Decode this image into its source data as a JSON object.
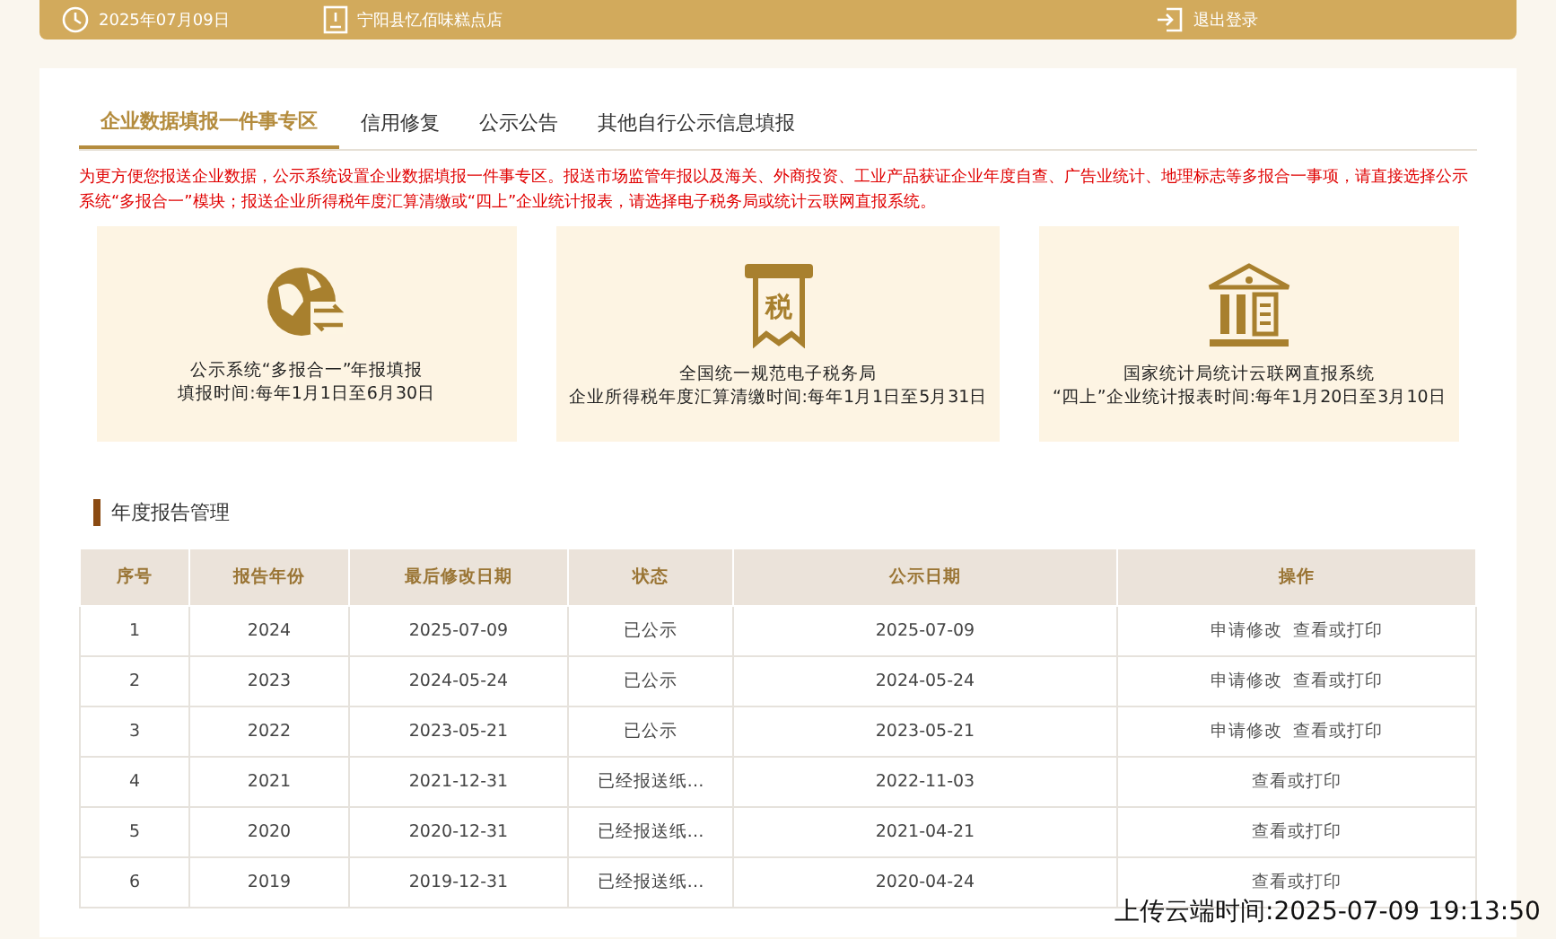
{
  "top_bar": {
    "date": "2025年07月09日",
    "store": "宁阳县忆佰味糕点店",
    "logout": "退出登录"
  },
  "tabs": [
    {
      "label": "企业数据填报一件事专区",
      "selected": true
    },
    {
      "label": "信用修复",
      "selected": false
    },
    {
      "label": "公示公告",
      "selected": false
    },
    {
      "label": "其他自行公示信息填报",
      "selected": false
    }
  ],
  "notice": "为更方便您报送企业数据，公示系统设置企业数据填报一件事专区。报送市场监管年报以及海关、外商投资、工业产品获证企业年度自查、广告业统计、地理标志等多报合一事项，请直接选择公示系统“多报合一”模块；报送企业所得税年度汇算清缴或“四上”企业统计报表，请选择电子税务局或统计云联网直报系统。",
  "cards": [
    {
      "kind": "globe",
      "title": "公示系统“多报合一”年报填报",
      "period": "填报时间:每年1月1日至6月30日"
    },
    {
      "kind": "tax",
      "icon_text": "税",
      "title": "全国统一规范电子税务局",
      "period": "企业所得税年度汇算清缴时间:每年1月1日至5月31日"
    },
    {
      "kind": "bank",
      "title": "国家统计局统计云联网直报系统",
      "period": "“四上”企业统计报表时间:每年1月20日至3月10日"
    }
  ],
  "section_title": "年度报告管理",
  "table": {
    "columns": [
      "序号",
      "报告年份",
      "最后修改日期",
      "状态",
      "公示日期",
      "操作"
    ],
    "rows": [
      {
        "cells": [
          "1",
          "2024",
          "2025-07-09",
          "已公示",
          "2025-07-09"
        ],
        "actions": [
          "申请修改",
          "查看或打印"
        ]
      },
      {
        "cells": [
          "2",
          "2023",
          "2024-05-24",
          "已公示",
          "2024-05-24"
        ],
        "actions": [
          "申请修改",
          "查看或打印"
        ]
      },
      {
        "cells": [
          "3",
          "2022",
          "2023-05-21",
          "已公示",
          "2023-05-21"
        ],
        "actions": [
          "申请修改",
          "查看或打印"
        ]
      },
      {
        "cells": [
          "4",
          "2021",
          "2021-12-31",
          "已经报送纸…",
          "2022-11-03"
        ],
        "actions": [
          "查看或打印"
        ]
      },
      {
        "cells": [
          "5",
          "2020",
          "2020-12-31",
          "已经报送纸…",
          "2021-04-21"
        ],
        "actions": [
          "查看或打印"
        ]
      },
      {
        "cells": [
          "6",
          "2019",
          "2019-12-31",
          "已经报送纸…",
          "2020-04-24"
        ],
        "actions": [
          "查看或打印"
        ]
      }
    ]
  },
  "upload_time": "上传云端时间:2025-07-09 19:13:50"
}
